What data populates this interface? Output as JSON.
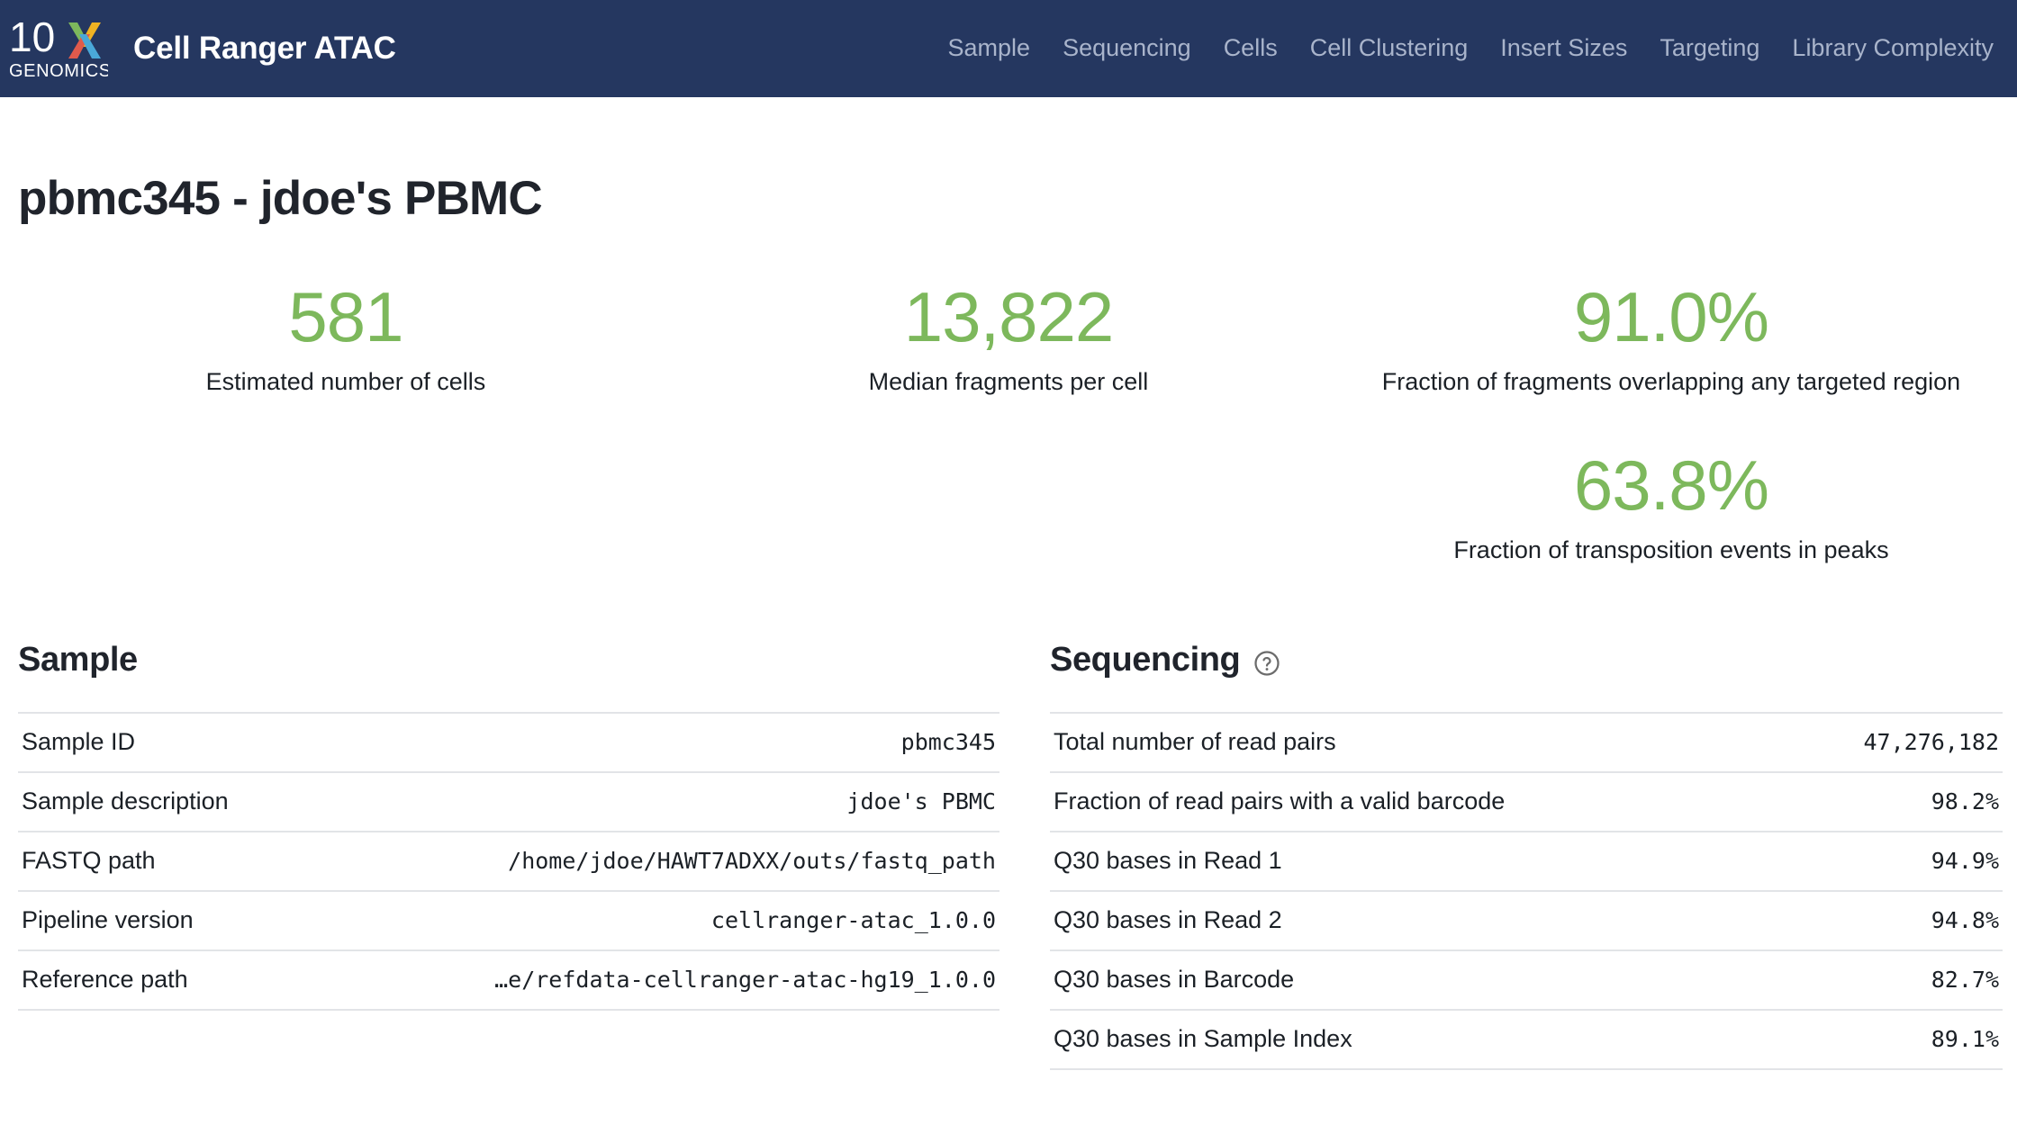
{
  "header": {
    "logo": {
      "name": "10x-genomics-logo",
      "wordmark": "10",
      "x_mark": "x",
      "subtext": "GENOMICS",
      "colors": {
        "arm_top_left": "#7db85c",
        "arm_top_right": "#f0b323",
        "arm_bottom_left": "#e05a4c",
        "arm_bottom_right": "#4aa8d8",
        "text": "#ffffff"
      }
    },
    "app_title": "Cell Ranger ATAC",
    "background_color": "#253760",
    "nav": [
      {
        "label": "Sample"
      },
      {
        "label": "Sequencing"
      },
      {
        "label": "Cells"
      },
      {
        "label": "Cell Clustering"
      },
      {
        "label": "Insert Sizes"
      },
      {
        "label": "Targeting"
      },
      {
        "label": "Library Complexity"
      }
    ]
  },
  "page": {
    "title": "pbmc345 - jdoe's PBMC"
  },
  "metrics": {
    "accent_color": "#7db85c",
    "cards": [
      {
        "value": "581",
        "label": "Estimated number of cells"
      },
      {
        "value": "13,822",
        "label": "Median fragments per cell"
      },
      {
        "value": "91.0%",
        "label": "Fraction of fragments overlapping any targeted region"
      },
      {
        "value": "63.8%",
        "label": "Fraction of transposition events in peaks"
      }
    ]
  },
  "sample_section": {
    "title": "Sample",
    "rows": [
      {
        "key": "Sample ID",
        "value": "pbmc345"
      },
      {
        "key": "Sample description",
        "value": "jdoe's PBMC"
      },
      {
        "key": "FASTQ path",
        "value": "/home/jdoe/HAWT7ADXX/outs/fastq_path"
      },
      {
        "key": "Pipeline version",
        "value": "cellranger-atac_1.0.0"
      },
      {
        "key": "Reference path",
        "value": "…e/refdata-cellranger-atac-hg19_1.0.0"
      }
    ]
  },
  "sequencing_section": {
    "title": "Sequencing",
    "help_icon": "help-circle-icon",
    "rows": [
      {
        "key": "Total number of read pairs",
        "value": "47,276,182"
      },
      {
        "key": "Fraction of read pairs with a valid barcode",
        "value": "98.2%"
      },
      {
        "key": "Q30 bases in Read 1",
        "value": "94.9%"
      },
      {
        "key": "Q30 bases in Read 2",
        "value": "94.8%"
      },
      {
        "key": "Q30 bases in Barcode",
        "value": "82.7%"
      },
      {
        "key": "Q30 bases in Sample Index",
        "value": "89.1%"
      }
    ]
  }
}
